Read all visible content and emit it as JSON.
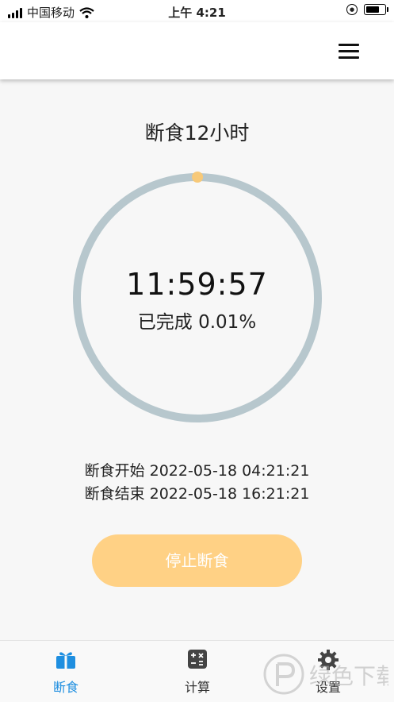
{
  "status_bar": {
    "carrier": "中国移动",
    "time": "上午 4:21",
    "icons": [
      "signal-icon",
      "wifi-icon",
      "orientation-lock-icon",
      "battery-icon"
    ]
  },
  "header": {
    "menu_icon": "hamburger-menu-icon"
  },
  "main": {
    "plan_title": "断食12小时",
    "timer": "11:59:57",
    "progress_text": "已完成 0.01%",
    "progress_fraction": 0.0001,
    "start_time": "断食开始 2022-05-18 04:21:21",
    "end_time": "断食结束 2022-05-18 16:21:21",
    "stop_button_label": "停止断食"
  },
  "tabs": [
    {
      "label": "断食",
      "icon": "fasting-gift-icon",
      "active": true
    },
    {
      "label": "计算",
      "icon": "calculator-icon",
      "active": false
    },
    {
      "label": "设置",
      "icon": "gear-icon",
      "active": false
    }
  ],
  "watermark": {
    "text": "绿色下载"
  },
  "colors": {
    "accent": "#1f8fe0",
    "button": "#ffd185",
    "ring_track": "#b7c7cd",
    "ring_dot": "#f7c979",
    "header_bg": "#ffffff",
    "page_bg": "#f7f7f7"
  }
}
